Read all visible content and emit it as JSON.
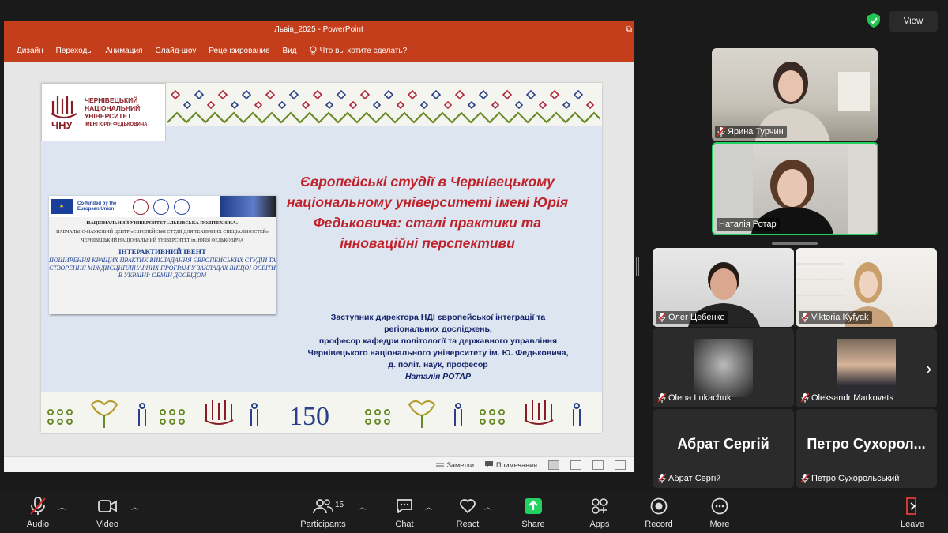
{
  "ppt": {
    "window_title": "Львів_2025 - PowerPoint",
    "ribbon_tabs": [
      "Дизайн",
      "Переходы",
      "Анимация",
      "Слайд-шоу",
      "Рецензирование",
      "Вид"
    ],
    "tell_me": "Что вы хотите сделать?",
    "status_notes": "Заметки",
    "status_comments": "Примечания"
  },
  "slide": {
    "logo_mark": "ЧНУ",
    "logo_lines": [
      "ЧЕРНІВЕЦЬКИЙ",
      "НАЦІОНАЛЬНИЙ",
      "УНІВЕРСИТЕТ"
    ],
    "logo_sub": "ІМЕНІ ЮРІЯ ФЕДЬКОВИЧА",
    "title": "Європейські студії в Чернівецькому національному університеті імені Юрія Федьковича: сталі практики та інноваційні перспективи",
    "poster": {
      "cofunded": "Co-funded by the European Union",
      "line1": "НАЦІОНАЛЬНИЙ УНІВЕРСИТЕТ «ЛЬВІВСЬКА ПОЛІТЕХНІКА»",
      "line2": "НАВЧАЛЬНО-НАУКОВИЙ ЦЕНТР «ЄВРОПЕЙСЬКІ СТУДІЇ ДЛЯ ТЕХНІЧНИХ СПЕЦІАЛЬНОСТЕЙ»",
      "line3": "ЧЕРНІВЕЦЬКИЙ НАЦІОНАЛЬНИЙ УНІВЕРСИТЕТ ім. ЮРІЯ ФЕДЬКОВИЧА",
      "event": "ІНТЕРАКТИВНИЙ ІВЕНТ",
      "desc": "ПОШИРЕННЯ КРАЩИХ ПРАКТИК ВИКЛАДАННЯ ЄВРОПЕЙСЬКИХ СТУДІЙ ТА СТВОРЕННЯ МІЖДИСЦИПЛІНАРНИХ ПРОГРАМ У ЗАКЛАДАХ ВИЩОЇ ОСВІТИ В УКРАЇНІ: ОБМІН ДОСВІДОМ"
    },
    "speaker_lines": [
      "Заступник директора НДІ європейської інтеграції та",
      "регіональних досліджень,",
      "професор кафедри політології та державного управління",
      "Чернівецького національного університету ім. Ю. Федьковича,",
      "д. політ. наук, професор"
    ],
    "speaker_name": "Наталія РОТАР",
    "ornament_number": "150"
  },
  "view_label": "View",
  "participants": [
    {
      "name": "Ярина Турчин"
    },
    {
      "name": "Наталія Ротар"
    },
    {
      "name": "Олег Цебенко"
    },
    {
      "name": "Viktoria Kyfyak"
    },
    {
      "name": "Olena Lukachuk"
    },
    {
      "name": "Oleksandr Markovets"
    },
    {
      "name": "Абрат Сергій",
      "display": "Абрат Сергій"
    },
    {
      "name": "Петро Сухорольський",
      "display": "Петро Сухорол..."
    }
  ],
  "toolbar": {
    "audio": "Audio",
    "video": "Video",
    "participants": "Participants",
    "participants_count": "15",
    "chat": "Chat",
    "react": "React",
    "share": "Share",
    "apps": "Apps",
    "record": "Record",
    "more": "More",
    "leave": "Leave"
  },
  "colors": {
    "ppt_accent": "#c43e1c",
    "slide_title": "#c0222b",
    "speaker_text": "#15246b",
    "active_speaker_border": "#23d160",
    "share_green": "#23d160"
  }
}
